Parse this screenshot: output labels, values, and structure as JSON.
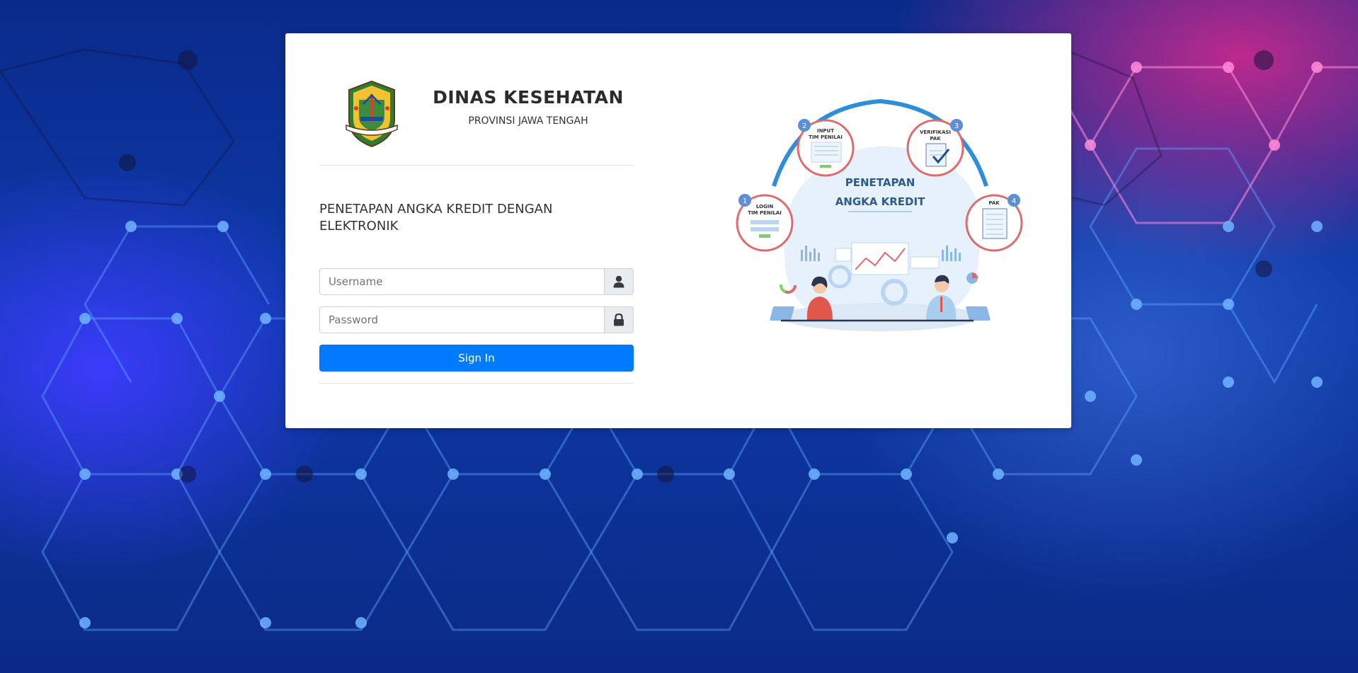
{
  "header": {
    "org_name": "DINAS KESEHATAN",
    "org_subtitle": "PROVINSI JAWA TENGAH"
  },
  "app": {
    "title": "PENETAPAN ANGKA KREDIT DENGAN ELEKTRONIK"
  },
  "form": {
    "username_placeholder": "Username",
    "username_value": "",
    "password_placeholder": "Password",
    "password_value": "",
    "signin_label": "Sign In"
  },
  "illustration": {
    "center_line1": "PENETAPAN",
    "center_line2": "ANGKA KREDIT",
    "steps": [
      {
        "number": "1",
        "line1": "LOGIN",
        "line2": "TIM PENILAI"
      },
      {
        "number": "2",
        "line1": "INPUT",
        "line2": "TIM PENILAI"
      },
      {
        "number": "3",
        "line1": "VERIFIKASI",
        "line2": "PAK"
      },
      {
        "number": "4",
        "line1": "PAK",
        "line2": ""
      }
    ]
  },
  "icons": {
    "username_addon": "user-icon",
    "password_addon": "lock-icon"
  },
  "colors": {
    "primary_button": "#007bff",
    "step_circle_border": "#e06a6a",
    "illustration_title": "#2e5c8a"
  }
}
